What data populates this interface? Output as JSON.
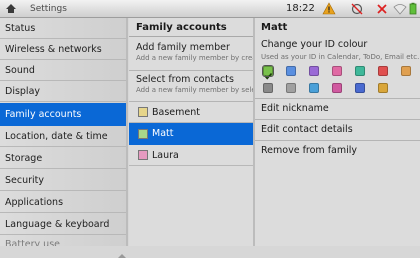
{
  "statusbar": {
    "title": "Settings",
    "time": "18:22",
    "icons": [
      "home-icon",
      "warning-icon",
      "alarm-off-icon",
      "close-icon",
      "wifi-icon",
      "battery-icon"
    ]
  },
  "settings_menu": {
    "items": [
      {
        "label": "Status"
      },
      {
        "label": "Wireless & networks"
      },
      {
        "label": "Sound"
      },
      {
        "label": "Display"
      },
      {
        "label": "Family accounts",
        "selected": true
      },
      {
        "label": "Location, date & time"
      },
      {
        "label": "Storage"
      },
      {
        "label": "Security"
      },
      {
        "label": "Applications"
      },
      {
        "label": "Language & keyboard"
      },
      {
        "label": "Battery use"
      }
    ]
  },
  "family": {
    "header": "Family accounts",
    "add_member": {
      "label": "Add family member",
      "sub": "Add a new family member by creating"
    },
    "select_contacts": {
      "label": "Select from contacts",
      "sub": "Add a new family member by selecting"
    },
    "members": [
      {
        "name": "Basement",
        "color": "#e6d58a"
      },
      {
        "name": "Matt",
        "color": "#a8d88a",
        "selected": true
      },
      {
        "name": "Laura",
        "color": "#e69ac0"
      }
    ]
  },
  "detail": {
    "header": "Matt",
    "colour_title": "Change your ID colour",
    "colour_sub": "Used as your ID in Calendar, ToDo, Email etc.",
    "colours": [
      "#79c14b",
      "#5a8fe0",
      "#9a6ad6",
      "#e06aa4",
      "#3fb89a",
      "#e05050",
      "#e0a050",
      "#8a8a8a",
      "#a0a0a0",
      "#4aa0d8",
      "#d05aa0",
      "#4a6ad0",
      "#d9a63a"
    ],
    "selected_colour_index": 0,
    "options": [
      "Edit nickname",
      "Edit contact details",
      "Remove from family"
    ]
  }
}
